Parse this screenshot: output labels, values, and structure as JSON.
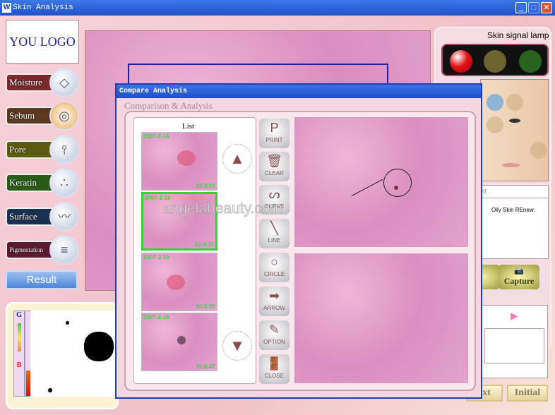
{
  "window": {
    "title": "Skin Analysis",
    "app_icon": "W",
    "minimize": "_",
    "maximize": "□",
    "close": "✕"
  },
  "sidebar": {
    "logo": "YOU LOGO",
    "items": [
      {
        "label": "Moisture",
        "icon": "water-drop-icon",
        "glyph": "💧",
        "color": "#7a2a2a"
      },
      {
        "label": "Sebum",
        "icon": "oil-ripple-icon",
        "glyph": "◎",
        "color": "#5a3a20"
      },
      {
        "label": "Pore",
        "icon": "hair-follicle-icon",
        "glyph": "⫯",
        "color": "#5a5a10"
      },
      {
        "label": "Keratin",
        "icon": "keratin-flakes-icon",
        "glyph": "∴",
        "color": "#2a5a18"
      },
      {
        "label": "Surface",
        "icon": "surface-wave-icon",
        "glyph": "〰",
        "color": "#1a3050"
      },
      {
        "label": "Pigmentation",
        "icon": "pigment-layers-icon",
        "glyph": "≡",
        "color": "#5a1a30"
      }
    ],
    "result": "Result"
  },
  "right": {
    "lamp_title": "Skin signal lamp",
    "lamps": [
      {
        "name": "red",
        "color": "#e0141c",
        "active": true
      },
      {
        "name": "yellow",
        "color": "#6e6230",
        "active": false
      },
      {
        "name": "green",
        "color": "#2a6220",
        "active": false
      }
    ],
    "suggest_header": "est",
    "suggest_text": "Oily Skin REnew:",
    "buttons": [
      "Capture"
    ],
    "nav": [
      "ext",
      "Initial"
    ]
  },
  "meter": {
    "top": "G",
    "bottom": "B",
    "level": 0.3
  },
  "dialog": {
    "title": "Compare Analysis",
    "subtitle": "Comparison & Analysis",
    "list_title": "List",
    "thumbnails": [
      {
        "date": "2007-2-16",
        "time": "10:3:19",
        "selected": false
      },
      {
        "date": "2007-2-16",
        "time": "10:4:31",
        "selected": true
      },
      {
        "date": "2007-2-16",
        "time": "10:5:02",
        "selected": false
      },
      {
        "date": "2007-2-16",
        "time": "10:6:47",
        "selected": false
      }
    ],
    "tools": [
      {
        "label": "PRINT",
        "glyph": "P"
      },
      {
        "label": "CLEAR",
        "glyph": "🗑"
      },
      {
        "label": "CURVE",
        "glyph": "ᔕ"
      },
      {
        "label": "LINE",
        "glyph": "╲"
      },
      {
        "label": "CIRCLE",
        "glyph": "○"
      },
      {
        "label": "ARROW",
        "glyph": "➡"
      },
      {
        "label": "OPTION",
        "glyph": "✎"
      },
      {
        "label": "CLOSE",
        "glyph": "🚪"
      }
    ],
    "scroll_up": "▲",
    "scroll_down": "▼"
  },
  "watermark": "angelabeauty.com"
}
